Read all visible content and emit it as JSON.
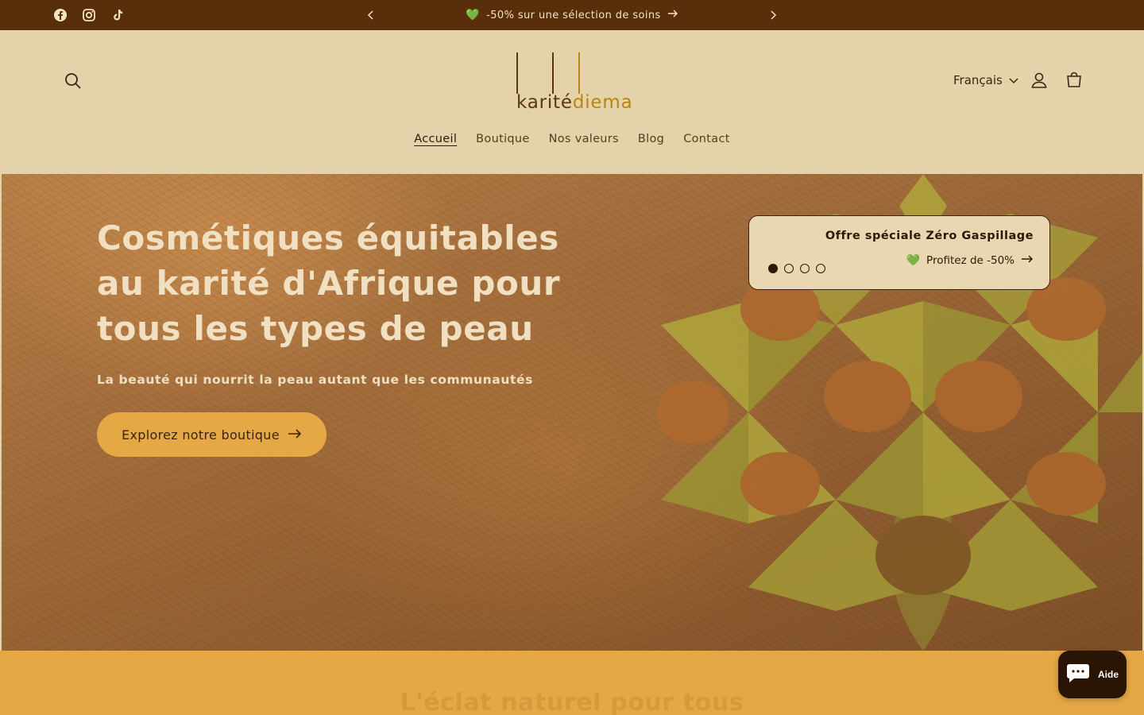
{
  "announcement": {
    "social_icons": [
      "facebook-icon",
      "instagram-icon",
      "tiktok-icon"
    ],
    "message": "-50% sur une sélection de soins",
    "heart": "💚"
  },
  "header": {
    "logo": {
      "part1": "karité",
      "part2": "diema"
    },
    "language": "Français",
    "nav": [
      "Accueil",
      "Boutique",
      "Nos valeurs",
      "Blog",
      "Contact"
    ],
    "active_nav": "Accueil"
  },
  "hero": {
    "title": "Cosmétiques équitables au karité d'Afrique pour tous les types de peau",
    "subtitle": "La beauté qui nourrit la peau autant que les communautés",
    "button_label": "Explorez notre boutique"
  },
  "offer": {
    "title": "Offre spéciale Zéro Gaspillage",
    "link_label": "Profitez de -50%",
    "heart": "💚",
    "slide_count": 4,
    "active_slide": 1
  },
  "band": {
    "title": "L'éclat naturel pour tous"
  },
  "chat": {
    "label": "Aide"
  },
  "colors": {
    "announcement_bg": "#582f0a",
    "header_bg": "#e4d2ab",
    "accent": "#e6a845",
    "text_dark": "#2d1906"
  }
}
